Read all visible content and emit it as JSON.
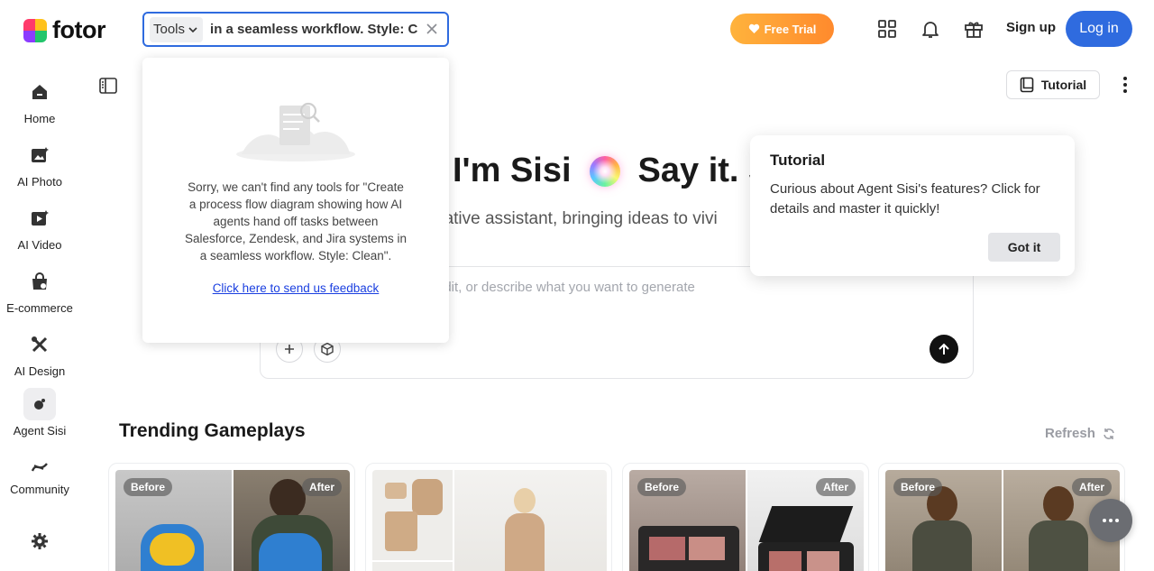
{
  "brand": {
    "name": "fotor"
  },
  "search": {
    "scope_label": "Tools",
    "query": "in a seamless workflow. Style: C",
    "empty_message": "Sorry, we can't find any tools for \"Create a process flow diagram showing how AI agents hand off tasks between Salesforce, Zendesk, and Jira systems in a seamless workflow. Style: Clean\".",
    "feedback_link": "Click here to send us feedback"
  },
  "header": {
    "free_trial": "Free Trial",
    "signup": "Sign up",
    "login": "Log in",
    "icons": [
      "apps-grid-icon",
      "bell-icon",
      "gift-icon"
    ]
  },
  "sidebar": {
    "items": [
      {
        "label": "Home",
        "icon": "home-icon"
      },
      {
        "label": "AI Photo",
        "icon": "ai-photo-icon"
      },
      {
        "label": "AI Video",
        "icon": "ai-video-icon"
      },
      {
        "label": "E-commerce",
        "icon": "shopping-bag-icon"
      },
      {
        "label": "AI Design",
        "icon": "design-tools-icon"
      },
      {
        "label": "Agent Sisi",
        "icon": "agent-sisi-icon",
        "active": true
      },
      {
        "label": "Community",
        "icon": "community-icon"
      }
    ],
    "settings_icon": "gear-icon"
  },
  "main": {
    "tutorial_button": "Tutorial",
    "hero_title_left": "I'm Sisi",
    "hero_title_right": "Say it. S",
    "hero_subtitle": "eative assistant, bringing ideas to vivi",
    "prompt_placeholder": "edit, or describe what you want to generate",
    "trending_title": "Trending Gameplays",
    "refresh_label": "Refresh",
    "cards": [
      {
        "before": "Before",
        "after": "After"
      },
      {
        "before": "",
        "after": ""
      },
      {
        "before": "Before",
        "after": "After"
      },
      {
        "before": "Before",
        "after": "After"
      }
    ]
  },
  "tutorial_popover": {
    "title": "Tutorial",
    "body": "Curious about Agent Sisi's features? Click for details and master it quickly!",
    "button": "Got it"
  },
  "colors": {
    "accent": "#2f6bdf",
    "trial_start": "#ffb33c",
    "trial_end": "#ff8a2d",
    "link": "#1a3fe0"
  }
}
